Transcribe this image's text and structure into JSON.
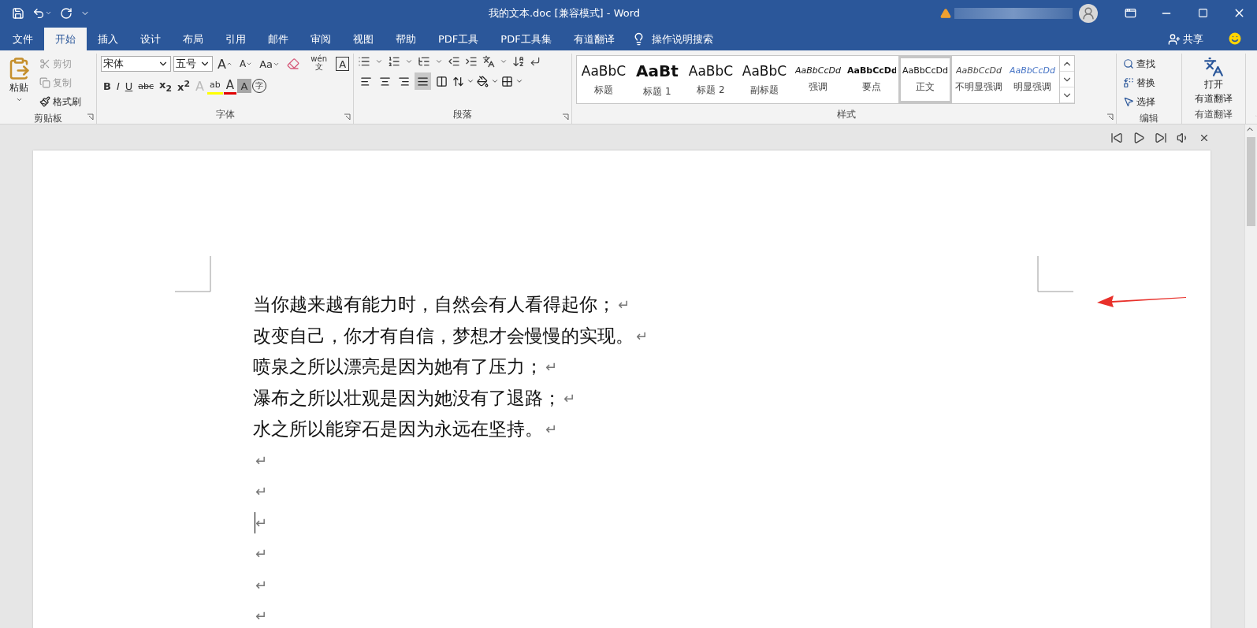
{
  "window": {
    "title": "我的文本.doc [兼容模式]  -  Word"
  },
  "tabs": [
    {
      "label": "文件",
      "selected": false
    },
    {
      "label": "开始",
      "selected": true
    },
    {
      "label": "插入",
      "selected": false
    },
    {
      "label": "设计",
      "selected": false
    },
    {
      "label": "布局",
      "selected": false
    },
    {
      "label": "引用",
      "selected": false
    },
    {
      "label": "邮件",
      "selected": false
    },
    {
      "label": "审阅",
      "selected": false
    },
    {
      "label": "视图",
      "selected": false
    },
    {
      "label": "帮助",
      "selected": false
    },
    {
      "label": "PDF工具",
      "selected": false
    },
    {
      "label": "PDF工具集",
      "selected": false
    },
    {
      "label": "有道翻译",
      "selected": false
    }
  ],
  "tell_me": {
    "placeholder": "操作说明搜索"
  },
  "share": {
    "label": "共享"
  },
  "clipboard": {
    "label": "剪贴板",
    "paste": "粘贴",
    "tools": [
      {
        "kind": "cut",
        "label": "剪切",
        "disabled": true
      },
      {
        "kind": "copy",
        "label": "复制",
        "disabled": true
      },
      {
        "kind": "painter",
        "label": "格式刷",
        "disabled": false
      }
    ]
  },
  "font": {
    "label": "字体",
    "font_name": "宋体",
    "font_size": "五号",
    "row1": [
      {
        "kind": "grow",
        "glyph": "A"
      },
      {
        "kind": "shrink",
        "glyph": "A"
      },
      {
        "kind": "case",
        "glyph": "Aa"
      },
      {
        "kind": "clear"
      },
      {
        "kind": "phonetic",
        "glyph": "wén",
        "sub": "文"
      },
      {
        "kind": "border",
        "glyph": "A"
      }
    ],
    "row2": [
      {
        "kind": "bold",
        "glyph": "B"
      },
      {
        "kind": "italic",
        "glyph": "I"
      },
      {
        "kind": "underline",
        "glyph": "U"
      },
      {
        "kind": "strike",
        "glyph": "abc"
      },
      {
        "kind": "sub",
        "glyph": "x$_{2}$"
      },
      {
        "kind": "sup",
        "glyph": "x$^{2}$"
      },
      {
        "kind": "effects",
        "glyph": "A"
      },
      {
        "kind": "highlight",
        "glyph": "ab"
      },
      {
        "kind": "color",
        "glyph": "A"
      },
      {
        "kind": "shading",
        "glyph": "A"
      },
      {
        "kind": "enclose",
        "glyph": "字"
      }
    ]
  },
  "paragraph": {
    "label": "段落",
    "alignment": [
      {
        "kind": "left",
        "selected": false
      },
      {
        "kind": "center",
        "selected": false
      },
      {
        "kind": "right",
        "selected": false
      },
      {
        "kind": "justify",
        "selected": true
      },
      {
        "kind": "distributed",
        "selected": false
      }
    ]
  },
  "styles": {
    "label": "样式",
    "items": [
      {
        "preview": "AaBbC",
        "name": "标题",
        "kind": "title",
        "selected": false
      },
      {
        "preview": "AaBt",
        "name": "标题 1",
        "kind": "heading1",
        "selected": false
      },
      {
        "preview": "AaBbC",
        "name": "标题 2",
        "kind": "heading2",
        "selected": false
      },
      {
        "preview": "AaBbC",
        "name": "副标题",
        "kind": "subtitle",
        "selected": false
      },
      {
        "preview": "AaBbCcDd",
        "name": "强调",
        "kind": "emphasis",
        "selected": false
      },
      {
        "preview": "AaBbCcDd",
        "name": "要点",
        "kind": "strong",
        "selected": false
      },
      {
        "preview": "AaBbCcDd",
        "name": "正文",
        "kind": "normal",
        "selected": true
      },
      {
        "preview": "AaBbCcDd",
        "name": "不明显强调",
        "kind": "subtle",
        "selected": false
      },
      {
        "preview": "AaBbCcDd",
        "name": "明显强调",
        "kind": "intense",
        "selected": false
      }
    ]
  },
  "editing": {
    "label": "编辑",
    "tools": [
      {
        "kind": "find",
        "label": "查找"
      },
      {
        "kind": "replace",
        "label": "替换"
      },
      {
        "kind": "select",
        "label": "选择"
      }
    ]
  },
  "youdao": {
    "label": "有道翻译",
    "button": [
      "打开",
      "有道翻译"
    ]
  },
  "document": {
    "paragraphs": [
      {
        "text": "当你越来越有能力时，自然会有人看得起你；",
        "mark": "↵",
        "cursor": false
      },
      {
        "text": "改变自己，你才有自信，梦想才会慢慢的实现。",
        "mark": "↵",
        "cursor": false
      },
      {
        "text": "喷泉之所以漂亮是因为她有了压力；",
        "mark": "↵",
        "cursor": false
      },
      {
        "text": "瀑布之所以壮观是因为她没有了退路；",
        "mark": "↵",
        "cursor": false
      },
      {
        "text": "水之所以能穿石是因为永远在坚持。",
        "mark": "↵",
        "cursor": false
      },
      {
        "mark": "↵",
        "cursor": false
      },
      {
        "mark": "↵",
        "cursor": false
      },
      {
        "mark": "↵",
        "cursor": true
      },
      {
        "mark": "↵",
        "cursor": false
      },
      {
        "mark": "↵",
        "cursor": false
      },
      {
        "mark": "↵",
        "cursor": false
      }
    ]
  }
}
